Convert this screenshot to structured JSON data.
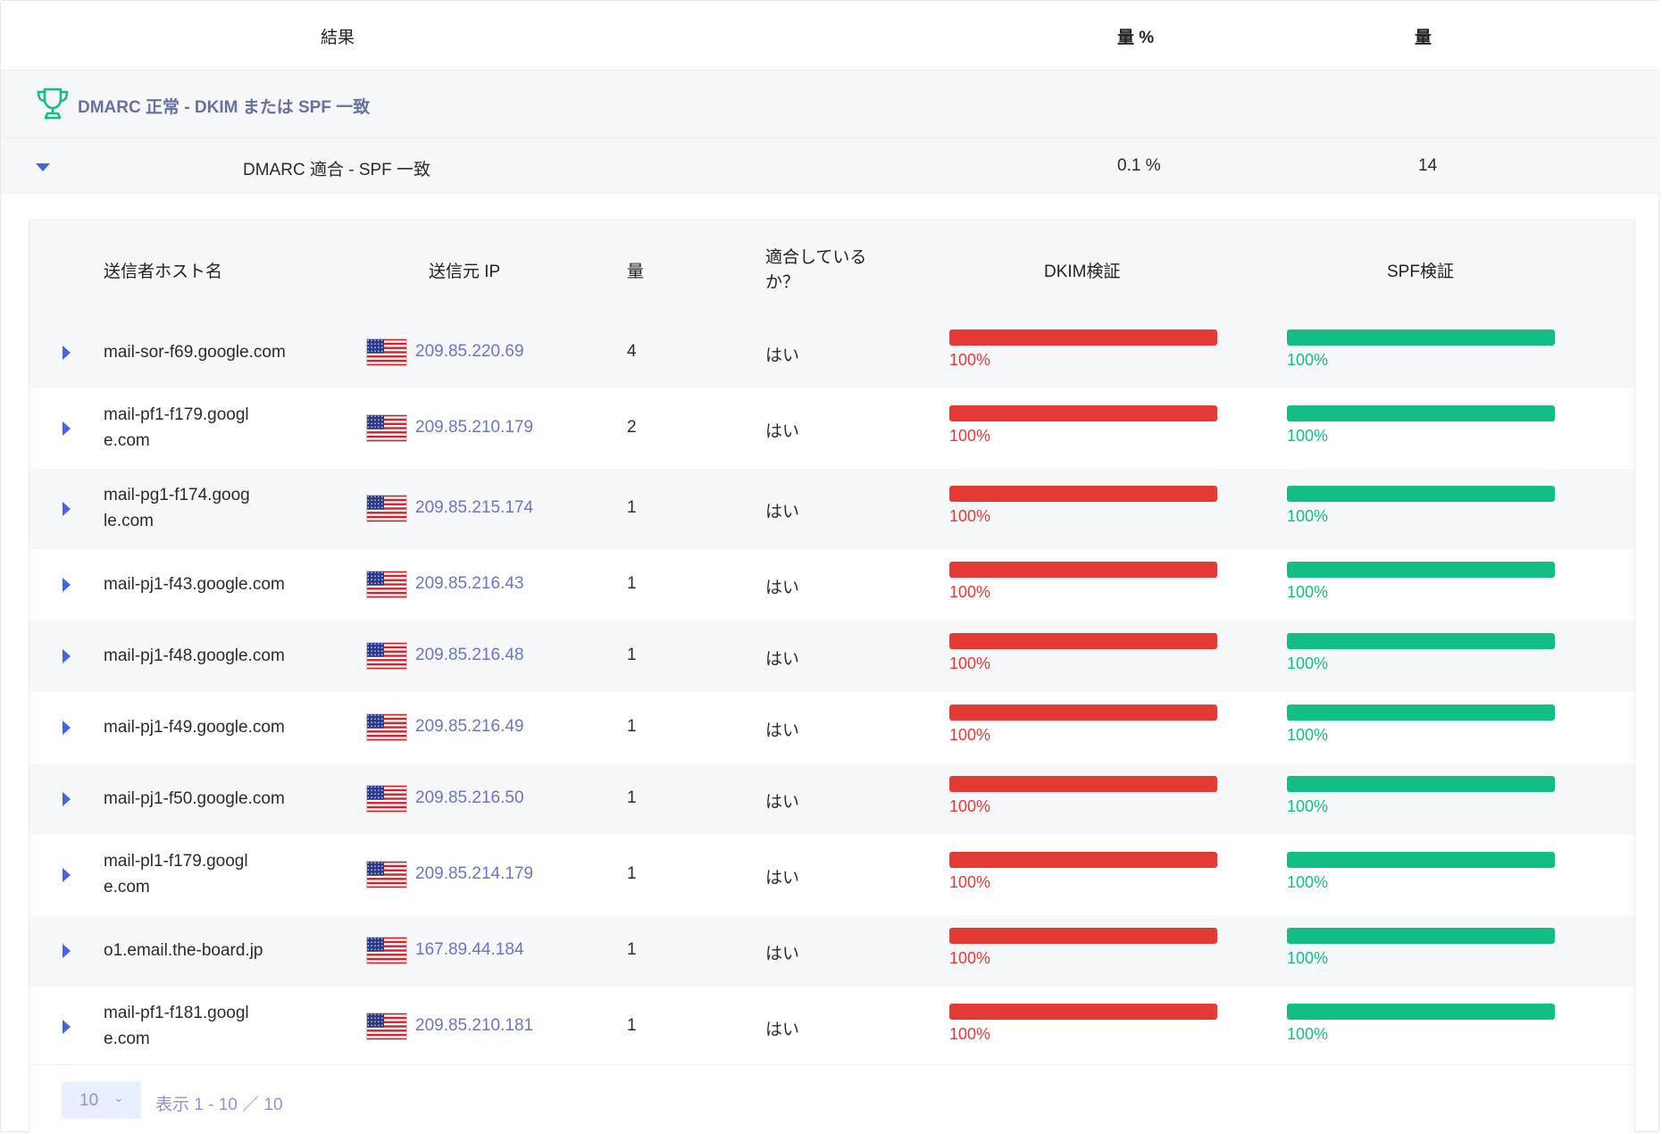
{
  "header": {
    "result_label": "結果",
    "volume_pct_label": "量 %",
    "volume_label": "量"
  },
  "group": {
    "title": "DMARC 正常 - DKIM または SPF 一致",
    "icon": "trophy-icon",
    "icon_color": "#12bd86"
  },
  "subgroup": {
    "label": "DMARC 適合 - SPF 一致",
    "volume_pct": "0.1 %",
    "volume": "14"
  },
  "table": {
    "columns": {
      "host": "送信者ホスト名",
      "ip": "送信元 IP",
      "volume": "量",
      "aligned": "適合している か？",
      "dkim": "DKIM検証",
      "spf": "SPF検証"
    },
    "rows": [
      {
        "host": "mail-sor-f69.google.com",
        "ip": "209.85.220.69",
        "volume": "4",
        "aligned": "はい",
        "dkim": "100%",
        "spf": "100%",
        "dkim_fill": 1.0,
        "spf_fill": 1.0
      },
      {
        "host": "mail-pf1-f179.google.com",
        "ip": "209.85.210.179",
        "volume": "2",
        "aligned": "はい",
        "dkim": "100%",
        "spf": "100%",
        "dkim_fill": 1.0,
        "spf_fill": 1.0
      },
      {
        "host": "mail-pg1-f174.google.com",
        "ip": "209.85.215.174",
        "volume": "1",
        "aligned": "はい",
        "dkim": "100%",
        "spf": "100%",
        "dkim_fill": 1.0,
        "spf_fill": 1.0
      },
      {
        "host": "mail-pj1-f43.google.com",
        "ip": "209.85.216.43",
        "volume": "1",
        "aligned": "はい",
        "dkim": "100%",
        "spf": "100%",
        "dkim_fill": 1.0,
        "spf_fill": 1.0
      },
      {
        "host": "mail-pj1-f48.google.com",
        "ip": "209.85.216.48",
        "volume": "1",
        "aligned": "はい",
        "dkim": "100%",
        "spf": "100%",
        "dkim_fill": 1.0,
        "spf_fill": 1.0
      },
      {
        "host": "mail-pj1-f49.google.com",
        "ip": "209.85.216.49",
        "volume": "1",
        "aligned": "はい",
        "dkim": "100%",
        "spf": "100%",
        "dkim_fill": 1.0,
        "spf_fill": 1.0
      },
      {
        "host": "mail-pj1-f50.google.com",
        "ip": "209.85.216.50",
        "volume": "1",
        "aligned": "はい",
        "dkim": "100%",
        "spf": "100%",
        "dkim_fill": 1.0,
        "spf_fill": 1.0
      },
      {
        "host": "mail-pl1-f179.google.com",
        "ip": "209.85.214.179",
        "volume": "1",
        "aligned": "はい",
        "dkim": "100%",
        "spf": "100%",
        "dkim_fill": 1.0,
        "spf_fill": 1.0
      },
      {
        "host": "o1.email.the-board.jp",
        "ip": "167.89.44.184",
        "volume": "1",
        "aligned": "はい",
        "dkim": "100%",
        "spf": "100%",
        "dkim_fill": 1.0,
        "spf_fill": 1.0
      },
      {
        "host": "mail-pf1-f181.google.com",
        "ip": "209.85.210.181",
        "volume": "1",
        "aligned": "はい",
        "dkim": "100%",
        "spf": "100%",
        "dkim_fill": 1.0,
        "spf_fill": 1.0
      }
    ]
  },
  "pager": {
    "page_size": "10",
    "info": "表示 1 - 10 ／ 10"
  },
  "colors": {
    "dkim_bar": "#e53935",
    "spf_bar": "#12bd86",
    "accent": "#4a63d9",
    "link": "#6b74c9"
  }
}
